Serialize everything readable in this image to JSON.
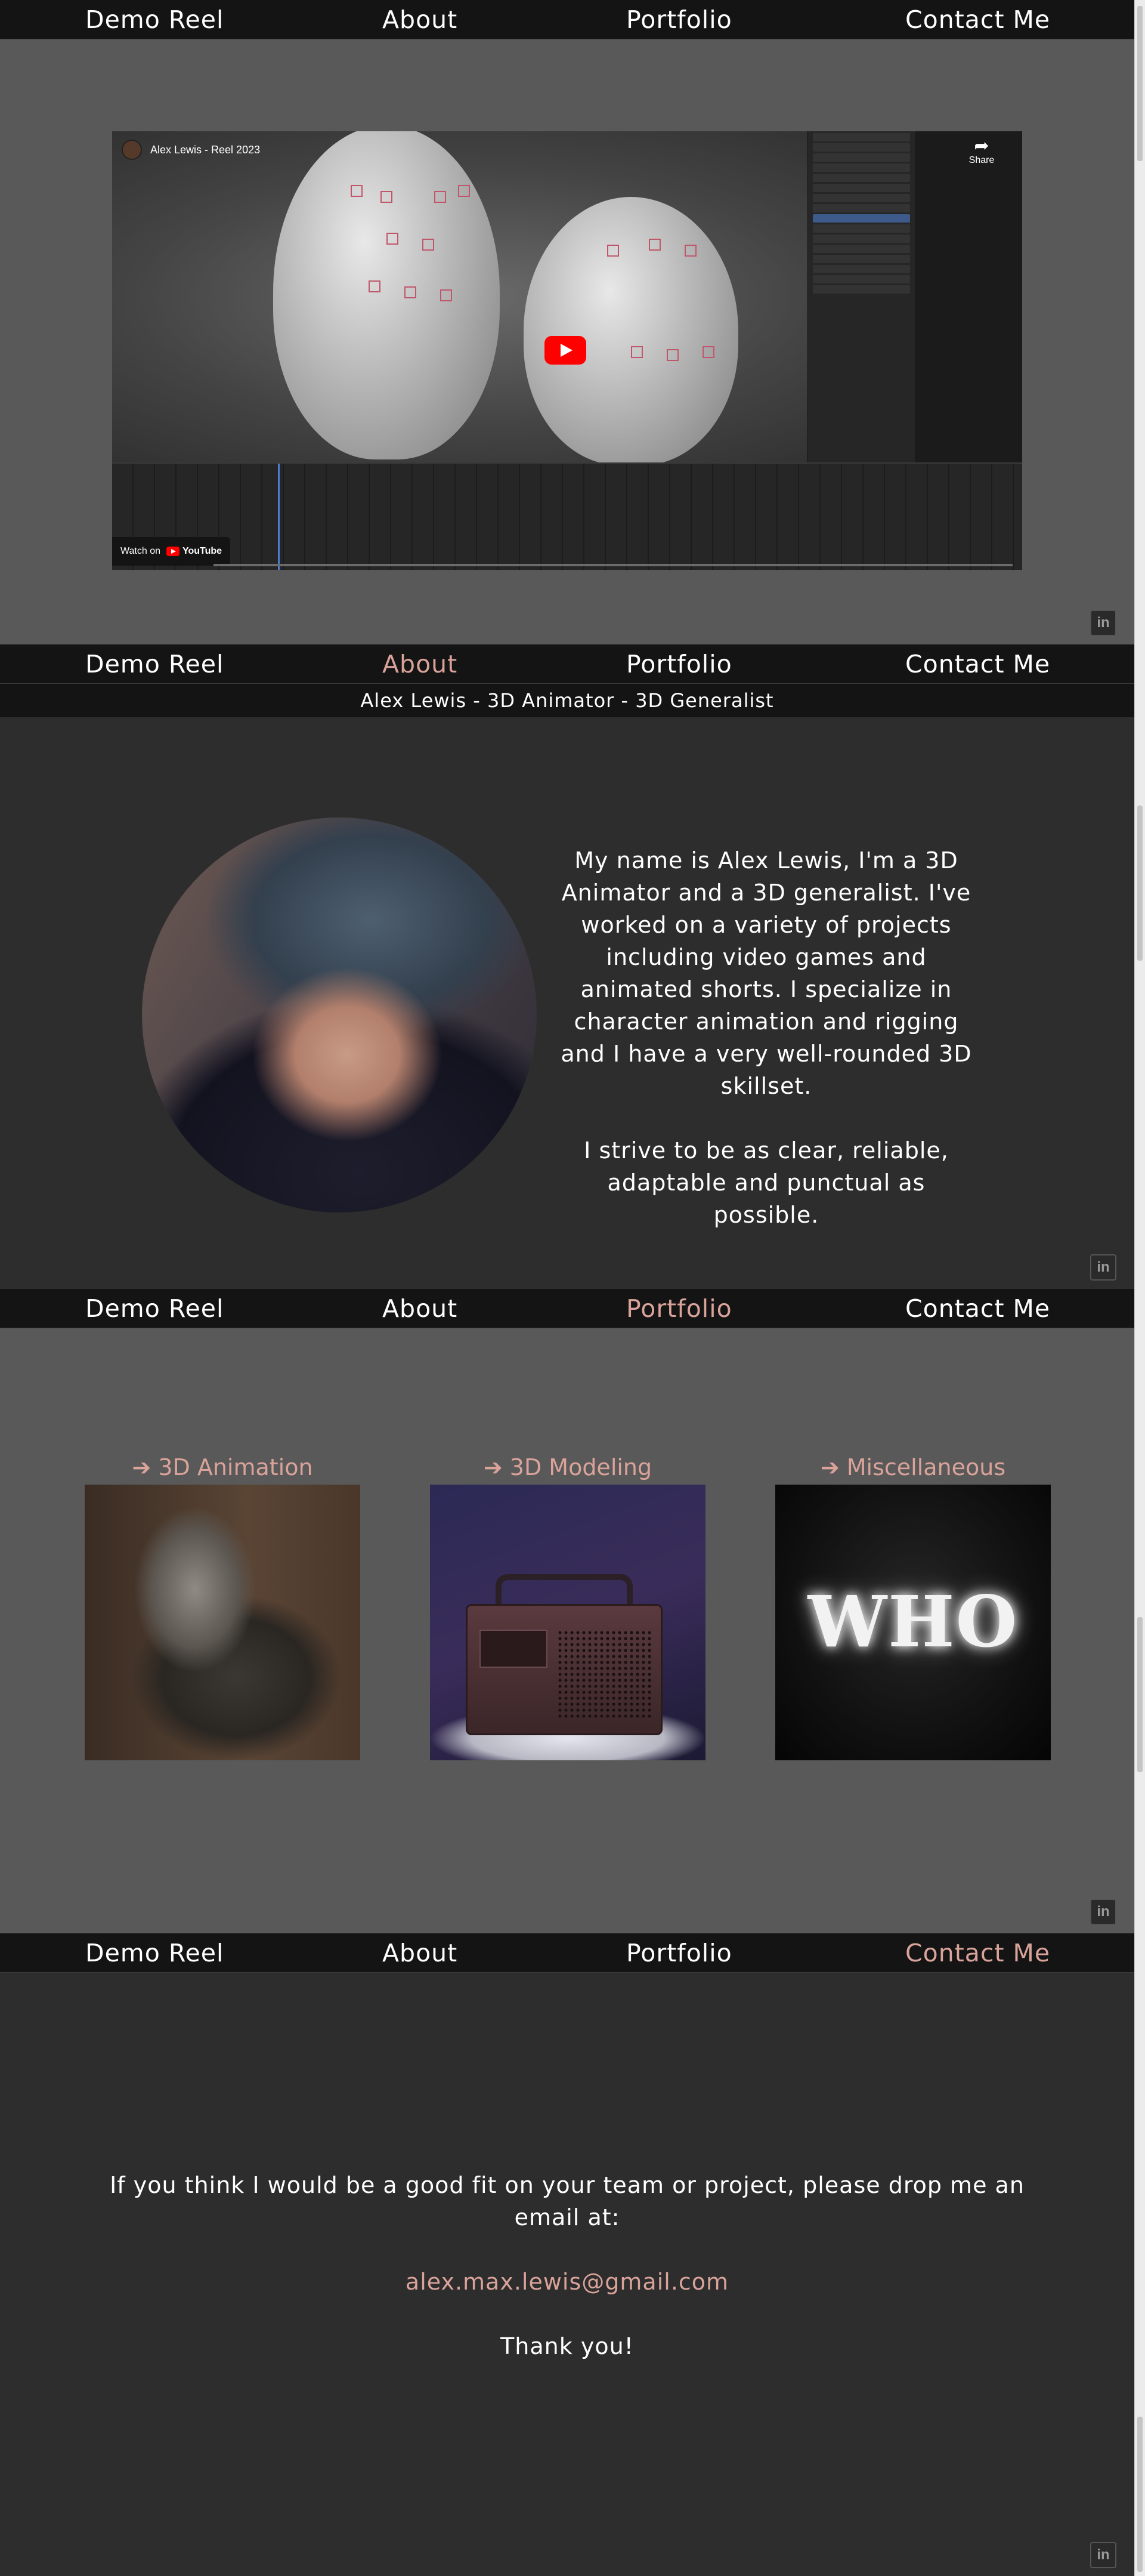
{
  "nav": {
    "demo_reel": "Demo Reel",
    "about": "About",
    "portfolio": "Portfolio",
    "contact": "Contact Me"
  },
  "video": {
    "title": "Alex Lewis - Reel 2023",
    "share_label": "Share",
    "watch_on_label": "Watch on",
    "youtube_label": "YouTube"
  },
  "linkedin_icon": "linkedin-icon",
  "about": {
    "subtitle": "Alex Lewis  -  3D Animator  -  3D Generalist",
    "paragraph_1": "My name is Alex Lewis, I'm a 3D Animator and a 3D generalist. I've worked on a variety of projects including video games and animated shorts. I specialize in character animation and rigging and I have a very well-rounded 3D skillset.",
    "paragraph_2": "I strive to be as clear, reliable, adaptable and punctual as possible."
  },
  "portfolio": {
    "items": [
      {
        "label": "➔ 3D Animation"
      },
      {
        "label": "➔ 3D Modeling"
      },
      {
        "label": "➔ Miscellaneous",
        "thumb_text": "WHO"
      }
    ]
  },
  "contact": {
    "message": "If you think I would be a good fit on your team or project, please drop me an email at:",
    "email": "alex.max.lewis@gmail.com",
    "thanks": "Thank you!"
  },
  "colors": {
    "accent": "#d9a39a",
    "nav_bg": "#141414",
    "section_light": "#595959",
    "section_dark": "#2d2d2d"
  }
}
